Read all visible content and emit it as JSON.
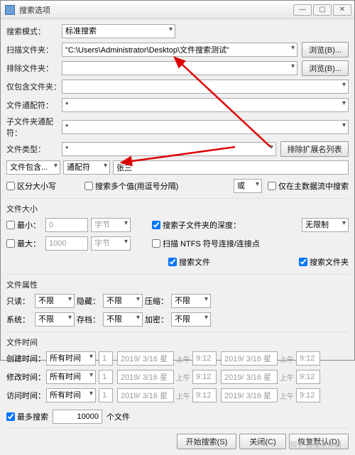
{
  "window": {
    "title": "搜索选项"
  },
  "winbtn": {
    "min": "—",
    "max": "▢",
    "close": "✕"
  },
  "labels": {
    "searchMode": "搜索模式：",
    "scanFolder": "扫描文件夹：",
    "excludeFolder": "排除文件夹：",
    "includeOnly": "仅包含文件夹：",
    "fileWildcard": "文件通配符：",
    "subWildcard": "子文件夹通配符：",
    "typeRow": "文件类型：",
    "containSel": "文件包含...",
    "wildcardSel": "通配符",
    "caseSens": "区分大小写",
    "multiSemi": "搜索多个值(用逗号分隔)",
    "or": "或",
    "hostOnly": "仅在主数据流中搜索",
    "sizeGroup": "文件大小",
    "min": "最小：",
    "max": "最大：",
    "bytes": "字节",
    "depthLabel": "搜索子文件夹的深度：",
    "noLimit": "无限制",
    "ntfs": "扫描 NTFS 符号连接/连接点",
    "searchFiles": "搜索文件",
    "searchFolders": "搜索文件夹",
    "attrGroup": "文件属性",
    "readonly": "只读：",
    "hidden": "隐藏：",
    "compressed": "压缩：",
    "system": "系统：",
    "archive": "存档：",
    "encrypted": "加密：",
    "noLimitAttr": "不限",
    "timeGroup": "文件时间",
    "created": "创建时间：",
    "modified": "修改时间：",
    "accessed": "访问时间：",
    "allTime": "所有时间",
    "am": "上午",
    "maxSearch": "最多搜索",
    "files": "个文件",
    "start": "开始搜索(S)",
    "close": "关闭(C)",
    "restore": "恢复默认(D)",
    "browse": "浏览(B)...",
    "excludeExt": "排除扩展名列表"
  },
  "values": {
    "searchMode": "标准搜索",
    "scanFolder": "\"C:\\Users\\Administrator\\Desktop\\文件搜索测试\"",
    "excludeFolder": "",
    "includeOnly": "",
    "fileWildcard": "*",
    "subWildcard": "*",
    "typeRow": "*",
    "nameVal": "张三",
    "minVal": "0",
    "maxVal": "1000",
    "maxSearch": "10000",
    "date": "2019/ 3/16 星",
    "time": "9:12"
  },
  "watermark": "知乎 @搜索神器"
}
